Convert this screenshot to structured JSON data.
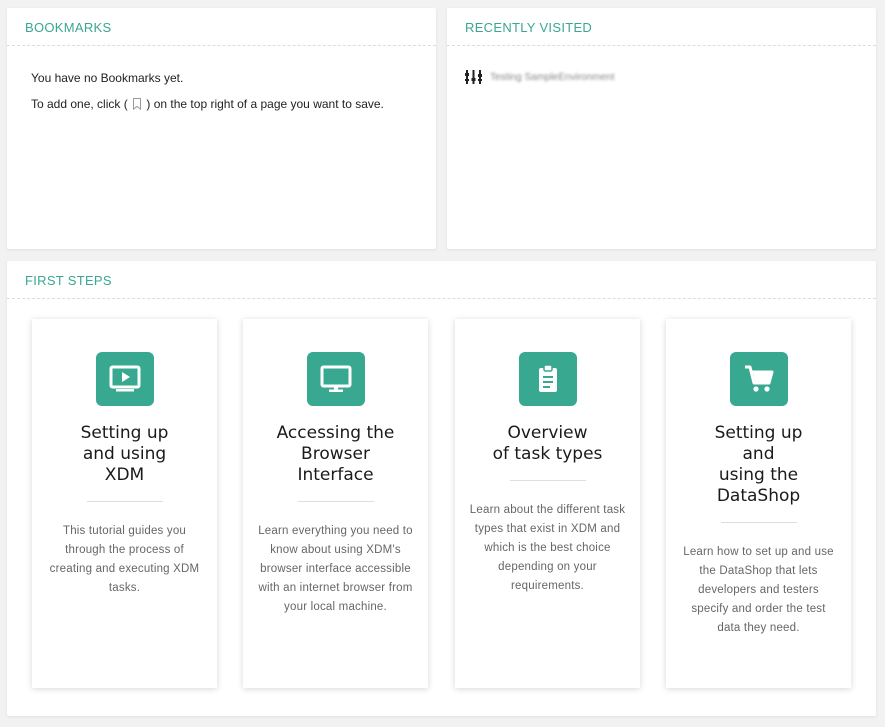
{
  "bookmarks": {
    "title": "BOOKMARKS",
    "empty_message": "You have no Bookmarks yet.",
    "hint_prefix": "To add one, click (",
    "hint_suffix": ") on the top right of a page you want to save."
  },
  "recently_visited": {
    "title": "RECENTLY VISITED",
    "items": [
      {
        "label": "Testing SampleEnvironment",
        "icon": "environment-icon"
      }
    ]
  },
  "first_steps": {
    "title": "FIRST STEPS",
    "cards": [
      {
        "icon": "tutorial-video-icon",
        "heading_lines": [
          "Setting up",
          "and using",
          "XDM"
        ],
        "description": "This tutorial guides you through the process of creating and executing XDM tasks."
      },
      {
        "icon": "monitor-icon",
        "heading_lines": [
          "Accessing the",
          "Browser",
          "Interface"
        ],
        "description": "Learn everything you need to know about using XDM's browser interface accessible with an internet browser from your local machine."
      },
      {
        "icon": "clipboard-icon",
        "heading_lines": [
          "Overview",
          "of task types"
        ],
        "description": "Learn about the different task types that exist in XDM and which is the best choice depending on your requirements."
      },
      {
        "icon": "shopping-cart-icon",
        "heading_lines": [
          "Setting up",
          "and",
          "using the",
          "DataShop"
        ],
        "description": "Learn how to set up and use the DataShop that lets developers and testers specify and order the test data they need."
      }
    ]
  },
  "colors": {
    "accent": "#3aa791",
    "icon_background": "#38a890",
    "background": "#f2f2f2"
  }
}
